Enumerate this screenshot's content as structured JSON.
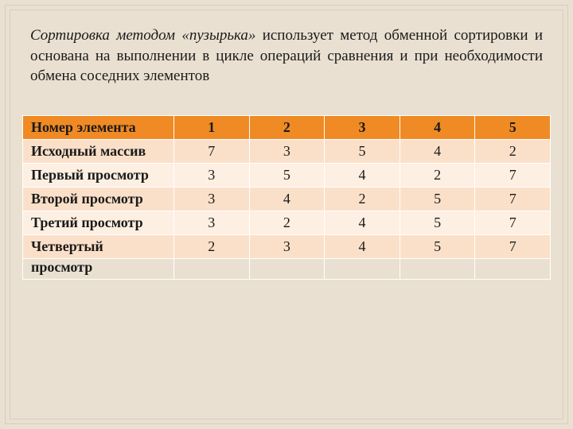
{
  "description": {
    "lead": "Сортировка методом «пузырька»",
    "rest": " использует метод обменной сортировки и основана на выполнении в цикле операций сравнения и при необходимости обмена соседних элементов"
  },
  "table": {
    "header_label": "Номер элемента",
    "columns": [
      "1",
      "2",
      "3",
      "4",
      "5"
    ],
    "rows": [
      {
        "label": "Исходный массив",
        "values": [
          "7",
          "3",
          "5",
          "4",
          "2"
        ]
      },
      {
        "label": "Первый просмотр",
        "values": [
          "3",
          "5",
          "4",
          "2",
          "7"
        ]
      },
      {
        "label": "Второй просмотр",
        "values": [
          "3",
          "4",
          "2",
          "5",
          "7"
        ]
      },
      {
        "label": "Третий просмотр",
        "values": [
          "3",
          "2",
          "4",
          "5",
          "7"
        ]
      },
      {
        "label": "Четвертый",
        "values": [
          "2",
          "3",
          "4",
          "5",
          "7"
        ]
      }
    ],
    "trailing_label": "просмотр"
  }
}
